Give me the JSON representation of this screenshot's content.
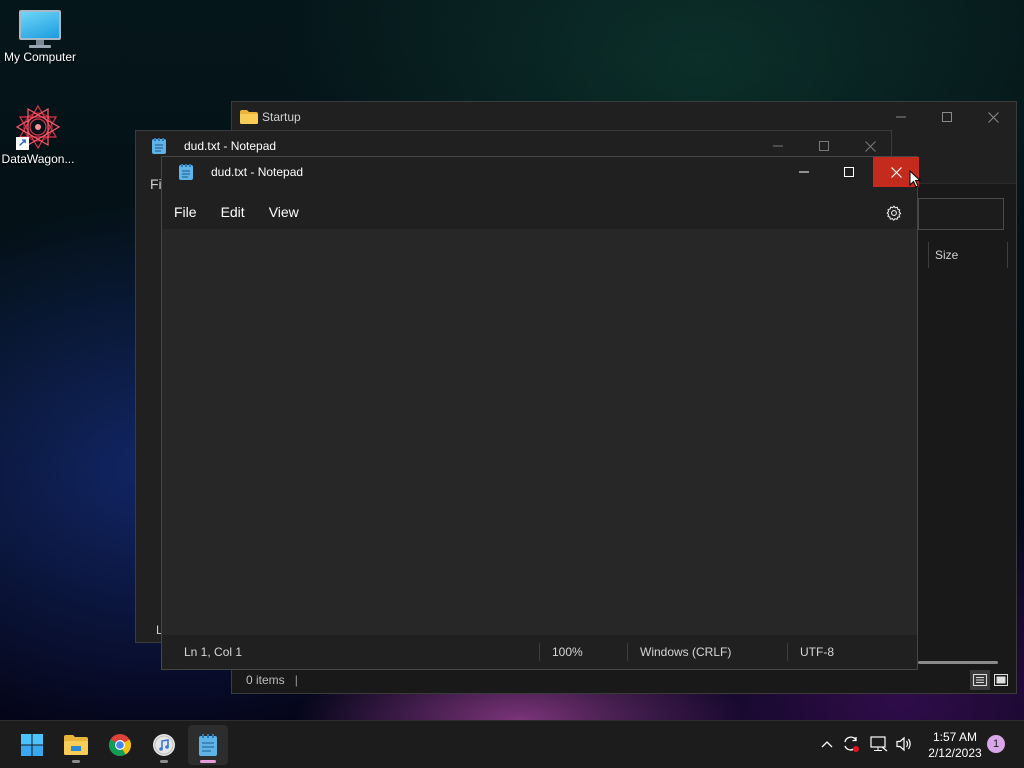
{
  "desktop": {
    "icons": [
      {
        "label": "My Computer",
        "icon": "monitor-icon"
      },
      {
        "label": "DataWagon...",
        "icon": "mandala-shortcut-icon"
      }
    ]
  },
  "explorer": {
    "title": "Startup",
    "column_size": "Size",
    "status_items": "0 items",
    "status_sep": "|",
    "icon": "folder-icon"
  },
  "notepad_back": {
    "title": "dud.txt - Notepad",
    "peek_menu": "Fi",
    "peek_status": "L"
  },
  "notepad": {
    "title": "dud.txt - Notepad",
    "menu": [
      "File",
      "Edit",
      "View"
    ],
    "content": "",
    "status": {
      "position": "Ln 1, Col 1",
      "zoom": "100%",
      "line_ending": "Windows (CRLF)",
      "encoding": "UTF-8"
    }
  },
  "taskbar": {
    "apps": [
      "start-icon",
      "file-explorer-icon",
      "chrome-icon",
      "itunes-icon",
      "notepad-icon"
    ],
    "clock_time": "1:57 AM",
    "clock_date": "2/12/2023",
    "notification_count": "1"
  },
  "colors": {
    "close_hover": "#c42b1c",
    "window_bg": "#202020",
    "editor_bg": "#272727",
    "active_indicator": "#e59cd9"
  }
}
